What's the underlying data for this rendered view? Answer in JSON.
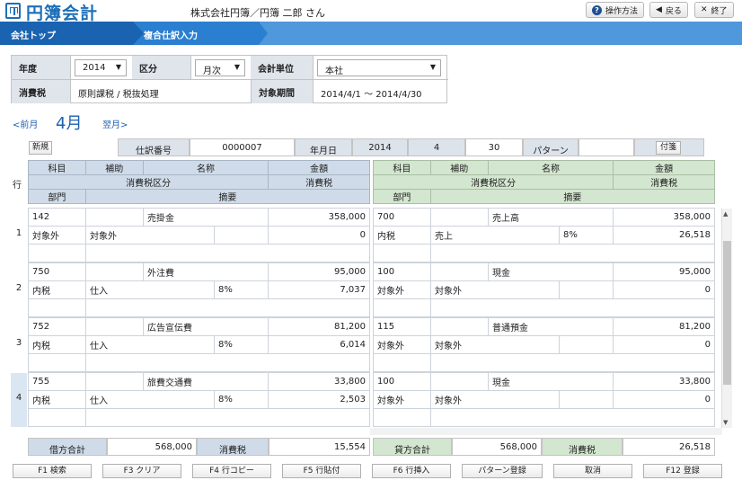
{
  "header": {
    "app_name": "円簿会計",
    "company_user": "株式会社円簿／円簿 二郎 さん",
    "buttons": {
      "help": "操作方法",
      "back": "戻る",
      "close": "終了"
    }
  },
  "breadcrumb": [
    "会社トップ",
    "複合仕訳入力"
  ],
  "criteria": {
    "year_label": "年度",
    "year_value": "2014",
    "division_label": "区分",
    "division_value": "月次",
    "unit_label": "会計単位",
    "unit_value": "本社",
    "tax_label": "消費税",
    "tax_value": "原則課税 / 税抜処理",
    "period_label": "対象期間",
    "period_value": "2014/4/1 ～ 2014/4/30"
  },
  "month_nav": {
    "prev": "<前月",
    "current": "4月",
    "next": "翌月>"
  },
  "slip": {
    "new_label": "新規",
    "number_label": "仕訳番号",
    "number_value": "0000007",
    "date_label": "年月日",
    "year": "2014",
    "month": "4",
    "day": "30",
    "pattern_label": "パターン",
    "pattern_value": "",
    "attach_label": "付箋"
  },
  "grid_header": {
    "row_label": "行",
    "left": {
      "account": "科目",
      "sub": "補助",
      "name": "名称",
      "amount": "金額",
      "tax_class": "消費税区分",
      "tax": "消費税",
      "dept": "部門",
      "memo": "摘要"
    },
    "right": {
      "account": "科目",
      "sub": "補助",
      "name": "名称",
      "amount": "金額",
      "tax_class": "消費税区分",
      "tax": "消費税",
      "dept": "部門",
      "memo": "摘要"
    }
  },
  "rows": [
    {
      "no": "1",
      "debit": {
        "code": "142",
        "sub": "",
        "name": "売掛金",
        "amount": "358,000",
        "tax_class": "対象外",
        "sub_tax": "対象外",
        "rate": "",
        "tax": "0"
      },
      "credit": {
        "code": "700",
        "sub": "",
        "name": "売上高",
        "amount": "358,000",
        "tax_class": "内税",
        "sub_tax": "売上",
        "rate": "8%",
        "tax": "26,518"
      }
    },
    {
      "no": "2",
      "debit": {
        "code": "750",
        "sub": "",
        "name": "外注費",
        "amount": "95,000",
        "tax_class": "内税",
        "sub_tax": "仕入",
        "rate": "8%",
        "tax": "7,037"
      },
      "credit": {
        "code": "100",
        "sub": "",
        "name": "現金",
        "amount": "95,000",
        "tax_class": "対象外",
        "sub_tax": "対象外",
        "rate": "",
        "tax": "0"
      }
    },
    {
      "no": "3",
      "debit": {
        "code": "752",
        "sub": "",
        "name": "広告宣伝費",
        "amount": "81,200",
        "tax_class": "内税",
        "sub_tax": "仕入",
        "rate": "8%",
        "tax": "6,014"
      },
      "credit": {
        "code": "115",
        "sub": "",
        "name": "普通預金",
        "amount": "81,200",
        "tax_class": "対象外",
        "sub_tax": "対象外",
        "rate": "",
        "tax": "0"
      }
    },
    {
      "no": "4",
      "debit": {
        "code": "755",
        "sub": "",
        "name": "旅費交通費",
        "amount": "33,800",
        "tax_class": "内税",
        "sub_tax": "仕入",
        "rate": "8%",
        "tax": "2,503"
      },
      "credit": {
        "code": "100",
        "sub": "",
        "name": "現金",
        "amount": "33,800",
        "tax_class": "対象外",
        "sub_tax": "対象外",
        "rate": "",
        "tax": "0"
      }
    }
  ],
  "totals": {
    "debit_label": "借方合計",
    "debit_value": "568,000",
    "debit_tax_label": "消費税",
    "debit_tax_value": "15,554",
    "credit_label": "貸方合計",
    "credit_value": "568,000",
    "credit_tax_label": "消費税",
    "credit_tax_value": "26,518"
  },
  "function_keys": [
    "F1 検索",
    "F3 クリア",
    "F4 行コピー",
    "F5 行貼付",
    "F6 行挿入",
    "パターン登録",
    "取消",
    "F12 登録"
  ],
  "colors": {
    "brand_blue": "#1d6fb8",
    "bar_blue": "#2b7fd0",
    "debit_header": "#cfdbe8",
    "credit_header": "#d3e6cf"
  }
}
